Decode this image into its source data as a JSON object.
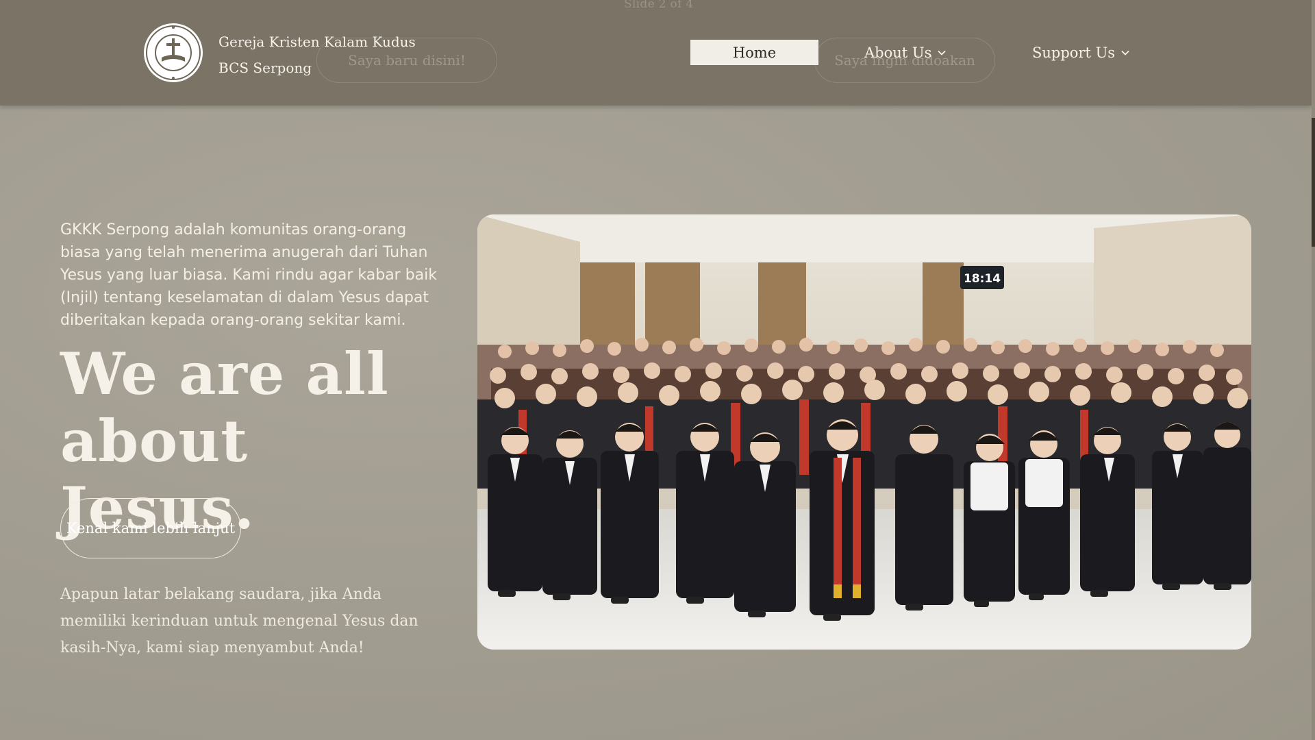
{
  "header": {
    "slide_counter": "Slide 2 of 4",
    "brand_line1": "Gereja Kristen Kalam Kudus",
    "brand_line2": "BCS Serpong",
    "logo_icon": "church-logo-icon",
    "ghost_button_1": "Saya baru disini!",
    "ghost_button_2": "Saya ingin didoakan",
    "nav": {
      "home": "Home",
      "about": "About Us",
      "support": "Support Us"
    }
  },
  "hero": {
    "intro": "GKKK Serpong adalah komunitas orang-orang biasa yang telah menerima anugerah dari Tuhan Yesus yang luar biasa. Kami rindu agar kabar baik (Injil) tentang keselamatan di dalam Yesus dapat diberitakan kepada orang-orang sekitar kami.",
    "headline_line1": "We are all",
    "headline_line2": "about Jesus.",
    "cta": "Kenal kami lebih lanjut",
    "welcome": "Apapun latar belakang saudara, jika Anda memiliki kerinduan untuk mengenal Yesus dan kasih-Nya, kami siap menyambut Anda!",
    "photo_clock": "18:14"
  },
  "colors": {
    "header_bg": "#7b7466",
    "page_bg": "#a39e92",
    "home_pill": "#f1eee7",
    "stole_red": "#c0392b"
  }
}
